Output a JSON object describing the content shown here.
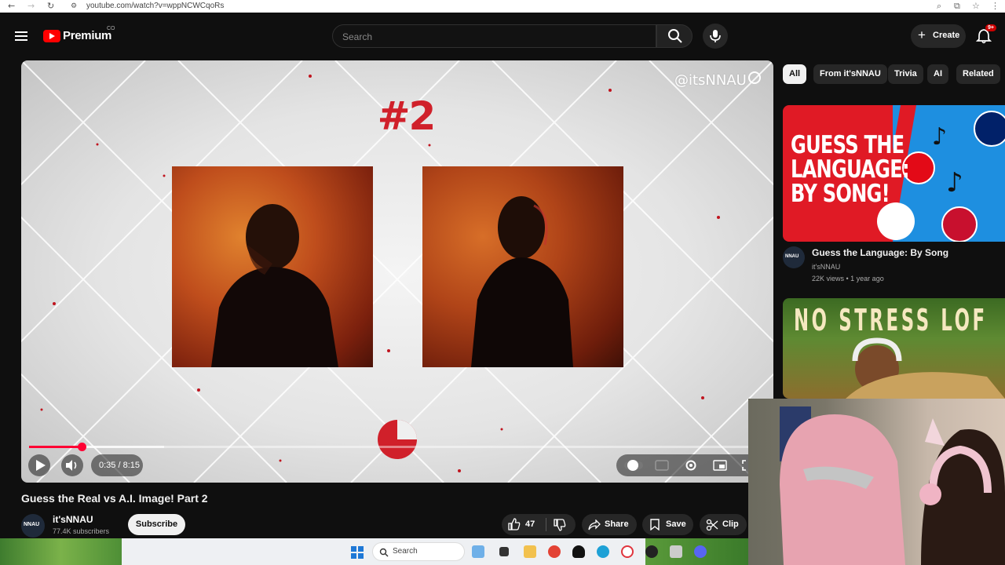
{
  "browser": {
    "url": "youtube.com/watch?v=wppNCWCqoRs"
  },
  "masthead": {
    "logo_text": "Premium",
    "logo_badge": "CO",
    "search_placeholder": "Search",
    "create_label": "Create",
    "notification_count": "9+"
  },
  "player": {
    "overlay_number": "#2",
    "watermark": "@itsNNAU",
    "time_display": "0:35 / 8:15",
    "progress": 0.071,
    "buffered": 0.19
  },
  "video": {
    "title": "Guess the Real vs A.I. Image! Part 2",
    "channel": {
      "name": "it'sNNAU",
      "avatar_text": "NNAU",
      "subscribers": "77.4K subscribers"
    },
    "subscribe_label": "Subscribe",
    "actions": {
      "likes": "47",
      "share": "Share",
      "save": "Save",
      "clip": "Clip"
    }
  },
  "chips": [
    "All",
    "From it'sNNAU",
    "Trivia",
    "AI",
    "Related"
  ],
  "sidebar": {
    "items": [
      {
        "thumbnail_text": "GUESS THE\nLANGUAGE:\nBY SONG!",
        "title": "Guess the Language: By Song",
        "channel": "it'sNNAU",
        "meta": "22K views • 1 year ago",
        "avatar_text": "NNAU"
      },
      {
        "thumbnail_text": "NO STRESS LOF"
      }
    ]
  },
  "taskbar": {
    "search_label": "Search"
  },
  "colors": {
    "accent_red": "#ff0033",
    "bg": "#0f0f0f",
    "chip_bg": "#272727"
  }
}
